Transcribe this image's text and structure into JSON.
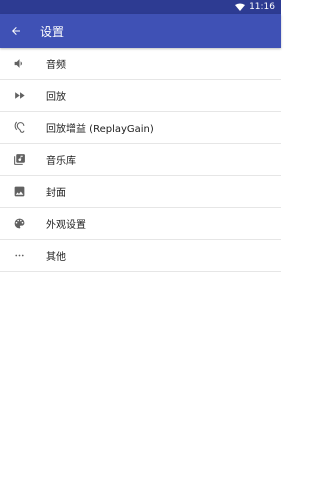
{
  "status_bar": {
    "time": "11:16"
  },
  "toolbar": {
    "title": "设置"
  },
  "settings": [
    {
      "label": "音频",
      "icon": "volume-icon"
    },
    {
      "label": "回放",
      "icon": "fast-forward-icon"
    },
    {
      "label": "回放增益 (ReplayGain)",
      "icon": "ear-icon"
    },
    {
      "label": "音乐库",
      "icon": "library-music-icon"
    },
    {
      "label": "封面",
      "icon": "image-icon"
    },
    {
      "label": "外观设置",
      "icon": "palette-icon"
    },
    {
      "label": "其他",
      "icon": "more-horiz-icon"
    }
  ],
  "colors": {
    "toolbar": "#3f51b5",
    "status_bar": "#2d3b92",
    "icon": "#616161",
    "divider": "#e6e6e6"
  }
}
